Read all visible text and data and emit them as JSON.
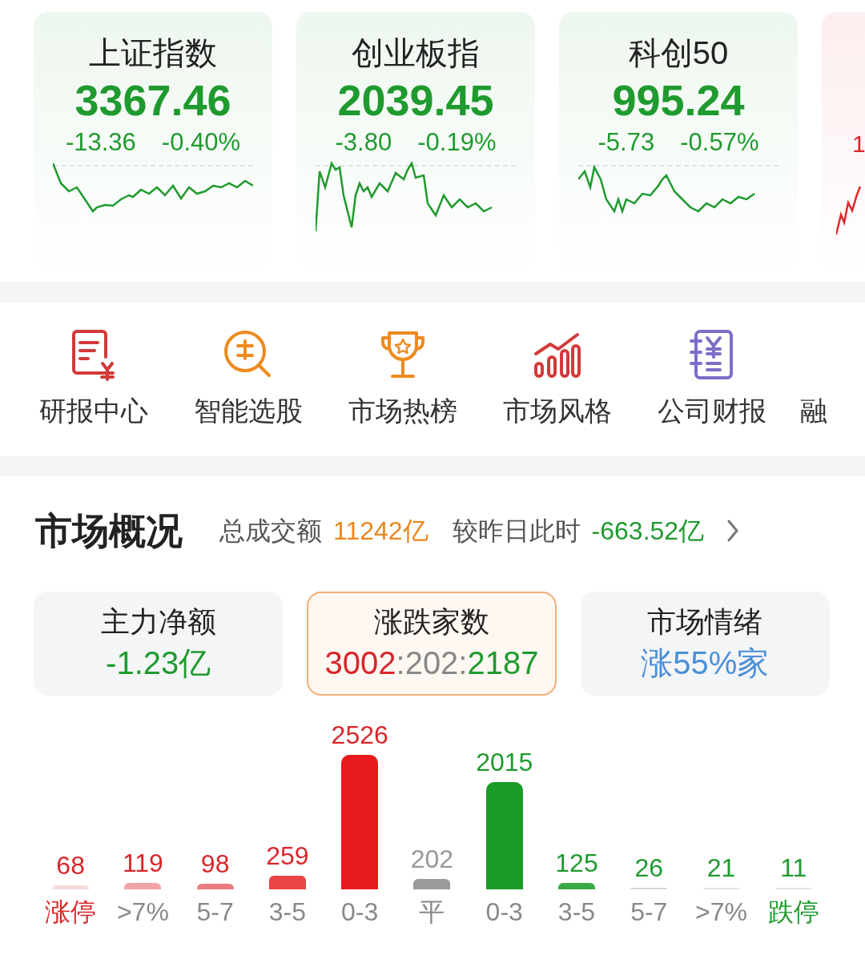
{
  "index_cards": [
    {
      "kind": "full",
      "title": "上证指数",
      "value": "3367.46",
      "change": "-13.36",
      "percent": "-0.40%",
      "color": "#1f9a2e"
    },
    {
      "kind": "full",
      "title": "创业板指",
      "value": "2039.45",
      "change": "-3.80",
      "percent": "-0.19%",
      "color": "#1f9a2e"
    },
    {
      "kind": "full",
      "title": "科创50",
      "value": "995.24",
      "change": "-5.73",
      "percent": "-0.57%",
      "color": "#1f9a2e"
    },
    {
      "kind": "partial",
      "change": "1",
      "color": "#e0262a"
    }
  ],
  "shortcuts": [
    {
      "label": "研报中心",
      "kind": "report"
    },
    {
      "label": "智能选股",
      "kind": "pick"
    },
    {
      "label": "市场热榜",
      "kind": "trophy"
    },
    {
      "label": "市场风格",
      "kind": "bars"
    },
    {
      "label": "公司财报",
      "kind": "ledger"
    },
    {
      "label": "融",
      "kind": "partial"
    }
  ],
  "overview": {
    "title": "市场概况",
    "turnover_label": "总成交额",
    "turnover": "11242亿",
    "compare_label": "较昨日此时",
    "compare": "-663.52亿",
    "stats": [
      {
        "label": "主力净额",
        "selected": false,
        "parts": [
          {
            "text": "-1.23亿",
            "color": "#1f9a2e"
          }
        ]
      },
      {
        "label": "涨跌家数",
        "selected": true,
        "parts": [
          {
            "text": "3002",
            "color": "#d9262a"
          },
          {
            "text": ":202:",
            "color": "#888888"
          },
          {
            "text": "2187",
            "color": "#1f9a2e"
          }
        ]
      },
      {
        "label": "市场情绪",
        "selected": false,
        "parts": [
          {
            "text": "涨55%家",
            "color": "#4a8fd9"
          }
        ]
      }
    ],
    "bar_value_labels": [
      {
        "color": "#d9262a"
      },
      {
        "color": "#d9262a"
      },
      {
        "color": "#d9262a"
      },
      {
        "color": "#d9262a"
      },
      {
        "color": "#d9262a"
      },
      {
        "color": "#999999"
      },
      {
        "color": "#1f9a2e"
      },
      {
        "color": "#1f9a2e"
      },
      {
        "color": "#1f9a2e"
      },
      {
        "color": "#1f9a2e"
      },
      {
        "color": "#1f9a2e"
      }
    ],
    "category_labels": [
      {
        "color": "#d9262a"
      },
      {
        "color": "#888888"
      },
      {
        "color": "#888888"
      },
      {
        "color": "#888888"
      },
      {
        "color": "#888888"
      },
      {
        "color": "#888888"
      },
      {
        "color": "#888888"
      },
      {
        "color": "#888888"
      },
      {
        "color": "#888888"
      },
      {
        "color": "#888888"
      },
      {
        "color": "#1f9a2e"
      }
    ],
    "chart_data": {
      "type": "bar",
      "categories": [
        "涨停",
        ">7%",
        "5-7",
        "3-5",
        "0-3",
        "平",
        "0-3",
        "3-5",
        "5-7",
        ">7%",
        "跌停"
      ],
      "values": [
        68,
        119,
        98,
        259,
        2526,
        202,
        2015,
        125,
        26,
        21,
        11
      ],
      "data_labels": true,
      "colors": [
        "#f7dcdc",
        "#f2a3a3",
        "#ec7c7c",
        "#e94545",
        "#e8191c",
        "#9a9a9a",
        "#1a9a29",
        "#3aaa45",
        "#d5d5d5",
        "#e5e5e5",
        "#e5e5e5"
      ]
    }
  }
}
